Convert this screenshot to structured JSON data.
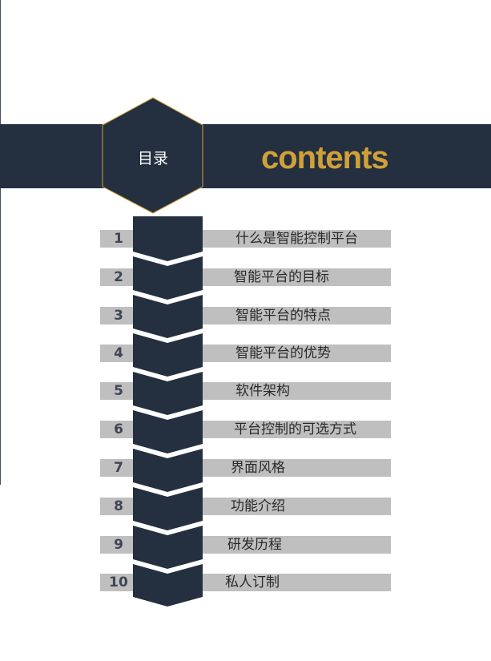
{
  "header": {
    "label": "目录",
    "word": "contents"
  },
  "toc": {
    "items": [
      {
        "number": "1",
        "title": "什么是智能控制平台"
      },
      {
        "number": "2",
        "title": "智能平台的目标"
      },
      {
        "number": "3",
        "title": "智能平台的特点"
      },
      {
        "number": "4",
        "title": "智能平台的优势"
      },
      {
        "number": "5",
        "title": "软件架构"
      },
      {
        "number": "6",
        "title": "平台控制的可选方式"
      },
      {
        "number": "7",
        "title": "界面风格"
      },
      {
        "number": "8",
        "title": "功能介绍"
      },
      {
        "number": "9",
        "title": "研发历程"
      },
      {
        "number": "10",
        "title": "私人订制"
      }
    ]
  },
  "colors": {
    "navy": "#243040",
    "gold": "#d2a038",
    "gray_bar": "#bfbfbf"
  }
}
